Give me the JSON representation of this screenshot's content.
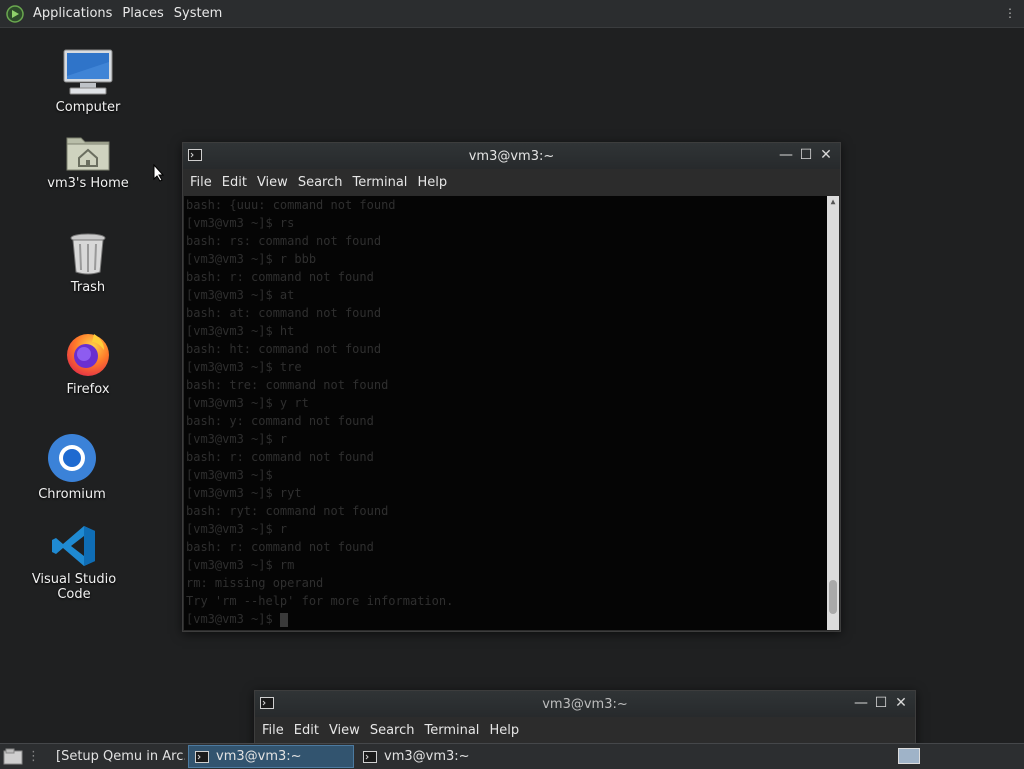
{
  "top_panel": {
    "menus": [
      "Applications",
      "Places",
      "System"
    ]
  },
  "desktop_icons": [
    {
      "name": "desktop-icon-computer",
      "label": "Computer",
      "icon": "computer-icon"
    },
    {
      "name": "desktop-icon-home",
      "label": "vm3's Home",
      "icon": "home-folder-icon"
    },
    {
      "name": "desktop-icon-trash",
      "label": "Trash",
      "icon": "trash-icon"
    },
    {
      "name": "desktop-icon-firefox",
      "label": "Firefox",
      "icon": "firefox-icon"
    },
    {
      "name": "desktop-icon-chromium",
      "label": "Chromium",
      "icon": "chromium-icon"
    },
    {
      "name": "desktop-icon-vscode",
      "label": "Visual Studio Code",
      "icon": "vscode-icon"
    }
  ],
  "terminal_main": {
    "title": "vm3@vm3:~",
    "menu": [
      "File",
      "Edit",
      "View",
      "Search",
      "Terminal",
      "Help"
    ],
    "lines": [
      "bash: {uuu: command not found",
      "[vm3@vm3 ~]$ rs",
      "bash: rs: command not found",
      "[vm3@vm3 ~]$ r bbb",
      "bash: r: command not found",
      "[vm3@vm3 ~]$ at",
      "bash: at: command not found",
      "[vm3@vm3 ~]$ ht",
      "bash: ht: command not found",
      "[vm3@vm3 ~]$ tre",
      "bash: tre: command not found",
      "[vm3@vm3 ~]$ y rt",
      "bash: y: command not found",
      "[vm3@vm3 ~]$ r",
      "bash: r: command not found",
      "[vm3@vm3 ~]$",
      "[vm3@vm3 ~]$ ryt",
      "bash: ryt: command not found",
      "[vm3@vm3 ~]$ r",
      "bash: r: command not found",
      "[vm3@vm3 ~]$ rm",
      "rm: missing operand",
      "Try 'rm --help' for more information.",
      "[vm3@vm3 ~]$ "
    ]
  },
  "terminal_second": {
    "title": "vm3@vm3:~",
    "menu": [
      "File",
      "Edit",
      "View",
      "Search",
      "Terminal",
      "Help"
    ]
  },
  "taskbar": {
    "items": [
      {
        "name": "taskbar-item-browser",
        "label": "[Setup Qemu in Arc...",
        "icon": "chromium-icon",
        "active": false
      },
      {
        "name": "taskbar-item-terminal-1",
        "label": "vm3@vm3:~",
        "icon": "terminal-icon",
        "active": true
      },
      {
        "name": "taskbar-item-terminal-2",
        "label": "vm3@vm3:~",
        "icon": "terminal-icon",
        "active": false
      }
    ]
  }
}
